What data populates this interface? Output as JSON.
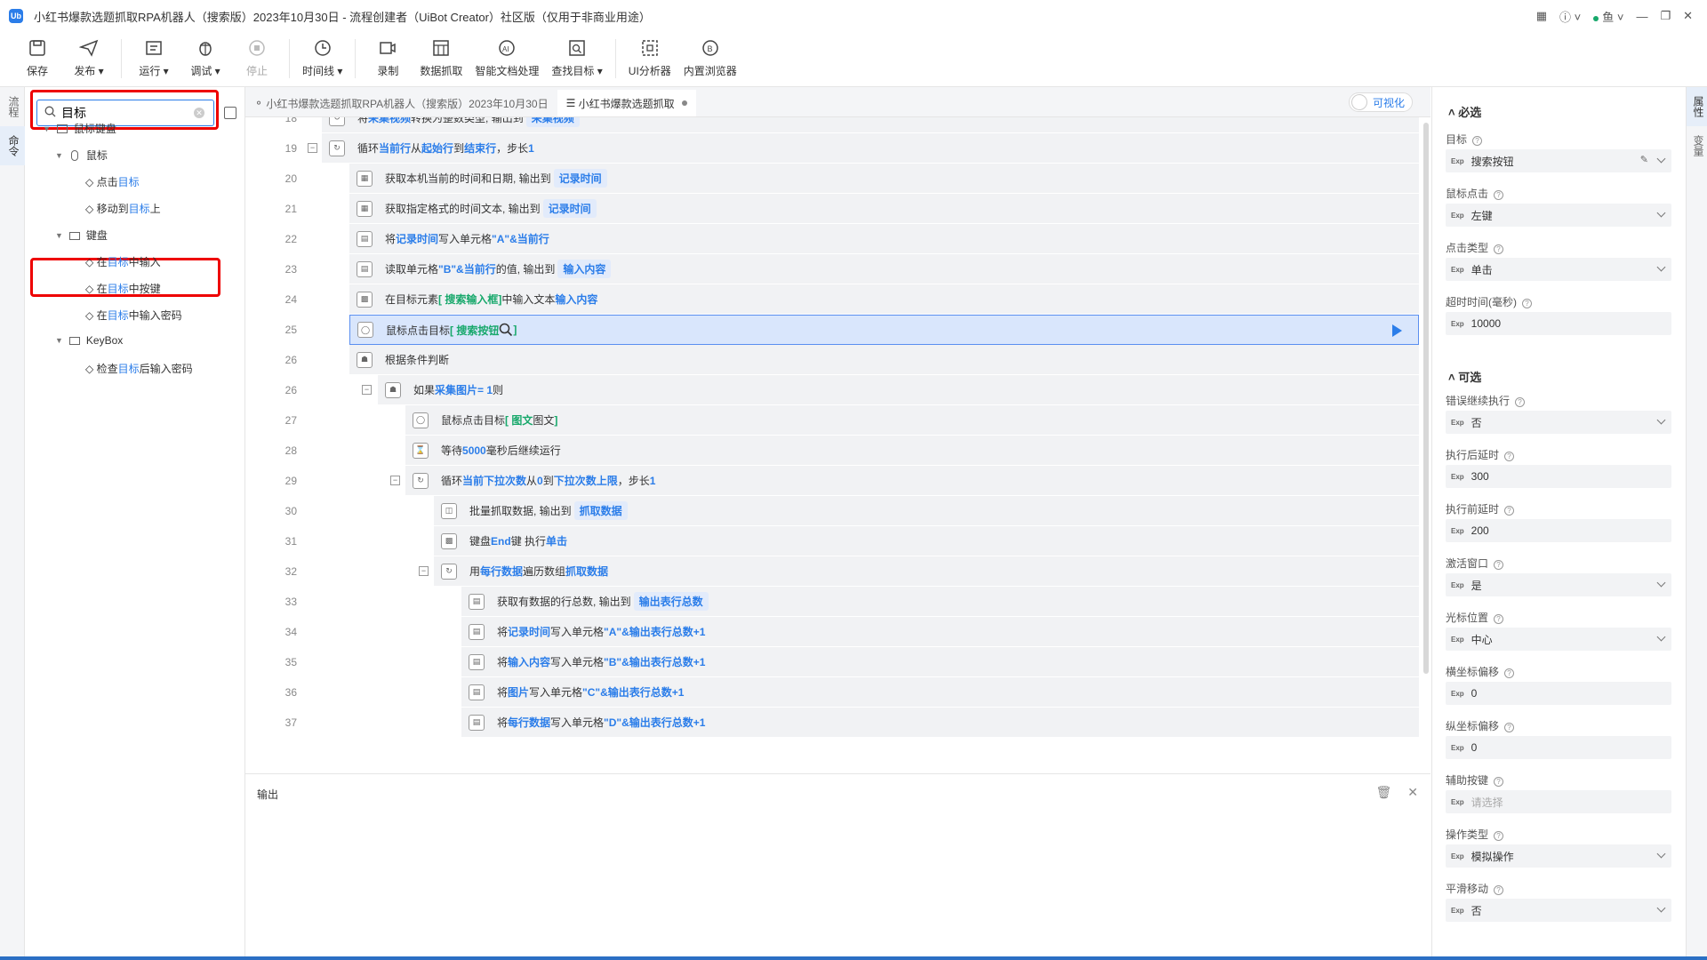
{
  "window": {
    "title": "小红书爆款选题抓取RPA机器人（搜索版）2023年10月30日 - 流程创建者（UiBot Creator）社区版（仅用于非商业用途）",
    "user": "鱼"
  },
  "toolbar": {
    "save": "保存",
    "publish": "发布",
    "run": "运行",
    "debug": "调试",
    "stop": "停止",
    "timeline": "时间线",
    "record": "录制",
    "data_scrape": "数据抓取",
    "smart_doc": "智能文档处理",
    "find_target": "查找目标",
    "ui_analyzer": "UI分析器",
    "builtin_browser": "内置浏览器"
  },
  "left_strip": {
    "tab_flow": "流程",
    "tab_command": "命令"
  },
  "right_strip": {
    "tab_property": "属性",
    "tab_variable": "变量"
  },
  "command_panel": {
    "search_value": "目标",
    "tree": [
      {
        "label": "鼠标键盘",
        "level": 0
      },
      {
        "label": "鼠标",
        "level": 1
      },
      {
        "pre": "点击",
        "hl": "目标",
        "post": "",
        "level": 2
      },
      {
        "pre": "移动到",
        "hl": "目标",
        "post": "上",
        "level": 2
      },
      {
        "label": "键盘",
        "level": 1
      },
      {
        "pre": "在",
        "hl": "目标",
        "post": "中输入",
        "level": 2
      },
      {
        "pre": "在",
        "hl": "目标",
        "post": "中按键",
        "level": 2
      },
      {
        "pre": "在",
        "hl": "目标",
        "post": "中输入密码",
        "level": 2
      },
      {
        "label": "KeyBox",
        "level": 1
      },
      {
        "pre": "检查",
        "hl": "目标",
        "post": "后输入密码",
        "level": 2
      }
    ]
  },
  "editor": {
    "tab1": "小红书爆款选题抓取RPA机器人（搜索版）2023年10月30日",
    "tab2": "小红书爆款选题抓取",
    "visualize": "可视化",
    "rows": [
      {
        "n": "18",
        "parts": [
          [
            "t",
            "将 "
          ],
          [
            "v",
            "采集视频"
          ],
          [
            "t",
            " 转换为整数类型, 输出到 "
          ],
          [
            "p",
            "采集视频"
          ]
        ]
      },
      {
        "n": "19",
        "parts": [
          [
            "t",
            "循环 "
          ],
          [
            "v",
            "当前行"
          ],
          [
            "t",
            " 从 "
          ],
          [
            "v",
            "起始行"
          ],
          [
            "t",
            " 到 "
          ],
          [
            "v",
            "结束行"
          ],
          [
            "t",
            " ，步长 "
          ],
          [
            "v",
            "1"
          ]
        ]
      },
      {
        "n": "20",
        "parts": [
          [
            "t",
            "获取本机当前的时间和日期, 输出到 "
          ],
          [
            "p",
            "记录时间"
          ]
        ]
      },
      {
        "n": "21",
        "parts": [
          [
            "t",
            "获取指定格式的时间文本, 输出到 "
          ],
          [
            "p",
            "记录时间"
          ]
        ]
      },
      {
        "n": "22",
        "parts": [
          [
            "t",
            "将 "
          ],
          [
            "v",
            "记录时间"
          ],
          [
            "t",
            " 写入单元格 "
          ],
          [
            "v",
            "\"A\"&当前行"
          ]
        ]
      },
      {
        "n": "23",
        "parts": [
          [
            "t",
            "读取单元格 "
          ],
          [
            "v",
            "\"B\"&当前行"
          ],
          [
            "t",
            " 的值, 输出到 "
          ],
          [
            "p",
            "输入内容"
          ]
        ]
      },
      {
        "n": "24",
        "parts": [
          [
            "t",
            "在目标元素 "
          ],
          [
            "g",
            "[ 搜索输入框"
          ],
          [
            "t",
            "        "
          ],
          [
            "g",
            "]"
          ],
          [
            "t",
            " 中输入文本 "
          ],
          [
            "v",
            "输入内容"
          ]
        ]
      },
      {
        "n": "25",
        "parts": [
          [
            "t",
            "鼠标点击目标 "
          ],
          [
            "g",
            "[ 搜索按钮"
          ],
          [
            "t",
            " "
          ],
          [
            "i",
            "search"
          ],
          [
            "t",
            " "
          ],
          [
            "g",
            "]"
          ]
        ]
      },
      {
        "n": "26",
        "parts": [
          [
            "t",
            "根据条件判断"
          ]
        ]
      },
      {
        "n": "26",
        "parts": [
          [
            "t",
            "如果 "
          ],
          [
            "v",
            "采集图片"
          ],
          [
            "t",
            " "
          ],
          [
            "v",
            "= 1"
          ],
          [
            "t",
            " 则"
          ]
        ]
      },
      {
        "n": "27",
        "parts": [
          [
            "t",
            "鼠标点击目标 "
          ],
          [
            "g",
            "[ 图文"
          ],
          [
            "t",
            "  图文  "
          ],
          [
            "g",
            "]"
          ]
        ]
      },
      {
        "n": "28",
        "parts": [
          [
            "t",
            "等待 "
          ],
          [
            "v",
            "5000"
          ],
          [
            "t",
            " 毫秒后继续运行"
          ]
        ]
      },
      {
        "n": "29",
        "parts": [
          [
            "t",
            "循环 "
          ],
          [
            "v",
            "当前下拉次数"
          ],
          [
            "t",
            " 从 "
          ],
          [
            "v",
            "0"
          ],
          [
            "t",
            " 到 "
          ],
          [
            "v",
            "下拉次数上限"
          ],
          [
            "t",
            " ，步长 "
          ],
          [
            "v",
            "1"
          ]
        ]
      },
      {
        "n": "30",
        "parts": [
          [
            "t",
            "批量抓取数据, 输出到 "
          ],
          [
            "p",
            "抓取数据"
          ]
        ]
      },
      {
        "n": "31",
        "parts": [
          [
            "t",
            "键盘 "
          ],
          [
            "v",
            "End"
          ],
          [
            "t",
            " 键 执行 "
          ],
          [
            "v",
            "单击"
          ]
        ]
      },
      {
        "n": "32",
        "parts": [
          [
            "t",
            "用 "
          ],
          [
            "v",
            "每行数据"
          ],
          [
            "t",
            " 遍历数组 "
          ],
          [
            "v",
            "抓取数据"
          ]
        ]
      },
      {
        "n": "33",
        "parts": [
          [
            "t",
            "获取有数据的行总数, 输出到 "
          ],
          [
            "p",
            "输出表行总数"
          ]
        ]
      },
      {
        "n": "34",
        "parts": [
          [
            "t",
            "将 "
          ],
          [
            "v",
            "记录时间"
          ],
          [
            "t",
            " 写入单元格 "
          ],
          [
            "v",
            "\"A\"&输出表行总数+1"
          ]
        ]
      },
      {
        "n": "35",
        "parts": [
          [
            "t",
            "将 "
          ],
          [
            "v",
            "输入内容"
          ],
          [
            "t",
            " 写入单元格 "
          ],
          [
            "v",
            "\"B\"&输出表行总数+1"
          ]
        ]
      },
      {
        "n": "36",
        "parts": [
          [
            "t",
            "将 "
          ],
          [
            "v",
            "图片"
          ],
          [
            "t",
            " 写入单元格 "
          ],
          [
            "v",
            "\"C\"&输出表行总数+1"
          ]
        ]
      },
      {
        "n": "37",
        "parts": [
          [
            "t",
            "将 "
          ],
          [
            "v",
            "每行数据"
          ],
          [
            "t",
            " 写入单元格 "
          ],
          [
            "v",
            "\"D\"&输出表行总数+1"
          ]
        ]
      }
    ]
  },
  "output": {
    "title": "输出"
  },
  "properties": {
    "required_title": "必选",
    "optional_title": "可选",
    "exp": "Exp",
    "required": [
      {
        "label": "目标",
        "value": "搜索按钮",
        "dropdown": true
      },
      {
        "label": "鼠标点击",
        "value": "左键",
        "dropdown": true
      },
      {
        "label": "点击类型",
        "value": "单击",
        "dropdown": true
      },
      {
        "label": "超时时间(毫秒)",
        "value": "10000",
        "dropdown": false
      }
    ],
    "optional": [
      {
        "label": "错误继续执行",
        "value": "否",
        "dropdown": true
      },
      {
        "label": "执行后延时",
        "value": "300",
        "dropdown": false
      },
      {
        "label": "执行前延时",
        "value": "200",
        "dropdown": false
      },
      {
        "label": "激活窗口",
        "value": "是",
        "dropdown": true
      },
      {
        "label": "光标位置",
        "value": "中心",
        "dropdown": true
      },
      {
        "label": "横坐标偏移",
        "value": "0",
        "dropdown": false
      },
      {
        "label": "纵坐标偏移",
        "value": "0",
        "dropdown": false
      },
      {
        "label": "辅助按键",
        "value": "请选择",
        "dropdown": false,
        "placeholder": true
      },
      {
        "label": "操作类型",
        "value": "模拟操作",
        "dropdown": true
      },
      {
        "label": "平滑移动",
        "value": "否",
        "dropdown": true
      }
    ]
  }
}
